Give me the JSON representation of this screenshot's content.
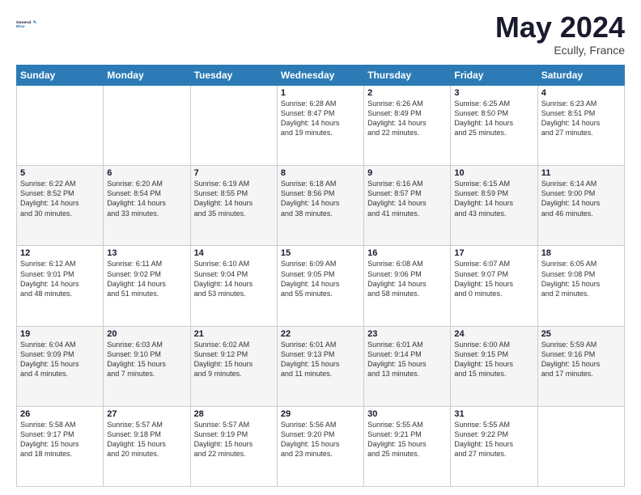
{
  "logo": {
    "line1": "General",
    "line2": "Blue"
  },
  "title": "May 2024",
  "location": "Ecully, France",
  "days_header": [
    "Sunday",
    "Monday",
    "Tuesday",
    "Wednesday",
    "Thursday",
    "Friday",
    "Saturday"
  ],
  "weeks": [
    [
      {
        "num": "",
        "info": ""
      },
      {
        "num": "",
        "info": ""
      },
      {
        "num": "",
        "info": ""
      },
      {
        "num": "1",
        "info": "Sunrise: 6:28 AM\nSunset: 8:47 PM\nDaylight: 14 hours\nand 19 minutes."
      },
      {
        "num": "2",
        "info": "Sunrise: 6:26 AM\nSunset: 8:49 PM\nDaylight: 14 hours\nand 22 minutes."
      },
      {
        "num": "3",
        "info": "Sunrise: 6:25 AM\nSunset: 8:50 PM\nDaylight: 14 hours\nand 25 minutes."
      },
      {
        "num": "4",
        "info": "Sunrise: 6:23 AM\nSunset: 8:51 PM\nDaylight: 14 hours\nand 27 minutes."
      }
    ],
    [
      {
        "num": "5",
        "info": "Sunrise: 6:22 AM\nSunset: 8:52 PM\nDaylight: 14 hours\nand 30 minutes."
      },
      {
        "num": "6",
        "info": "Sunrise: 6:20 AM\nSunset: 8:54 PM\nDaylight: 14 hours\nand 33 minutes."
      },
      {
        "num": "7",
        "info": "Sunrise: 6:19 AM\nSunset: 8:55 PM\nDaylight: 14 hours\nand 35 minutes."
      },
      {
        "num": "8",
        "info": "Sunrise: 6:18 AM\nSunset: 8:56 PM\nDaylight: 14 hours\nand 38 minutes."
      },
      {
        "num": "9",
        "info": "Sunrise: 6:16 AM\nSunset: 8:57 PM\nDaylight: 14 hours\nand 41 minutes."
      },
      {
        "num": "10",
        "info": "Sunrise: 6:15 AM\nSunset: 8:59 PM\nDaylight: 14 hours\nand 43 minutes."
      },
      {
        "num": "11",
        "info": "Sunrise: 6:14 AM\nSunset: 9:00 PM\nDaylight: 14 hours\nand 46 minutes."
      }
    ],
    [
      {
        "num": "12",
        "info": "Sunrise: 6:12 AM\nSunset: 9:01 PM\nDaylight: 14 hours\nand 48 minutes."
      },
      {
        "num": "13",
        "info": "Sunrise: 6:11 AM\nSunset: 9:02 PM\nDaylight: 14 hours\nand 51 minutes."
      },
      {
        "num": "14",
        "info": "Sunrise: 6:10 AM\nSunset: 9:04 PM\nDaylight: 14 hours\nand 53 minutes."
      },
      {
        "num": "15",
        "info": "Sunrise: 6:09 AM\nSunset: 9:05 PM\nDaylight: 14 hours\nand 55 minutes."
      },
      {
        "num": "16",
        "info": "Sunrise: 6:08 AM\nSunset: 9:06 PM\nDaylight: 14 hours\nand 58 minutes."
      },
      {
        "num": "17",
        "info": "Sunrise: 6:07 AM\nSunset: 9:07 PM\nDaylight: 15 hours\nand 0 minutes."
      },
      {
        "num": "18",
        "info": "Sunrise: 6:05 AM\nSunset: 9:08 PM\nDaylight: 15 hours\nand 2 minutes."
      }
    ],
    [
      {
        "num": "19",
        "info": "Sunrise: 6:04 AM\nSunset: 9:09 PM\nDaylight: 15 hours\nand 4 minutes."
      },
      {
        "num": "20",
        "info": "Sunrise: 6:03 AM\nSunset: 9:10 PM\nDaylight: 15 hours\nand 7 minutes."
      },
      {
        "num": "21",
        "info": "Sunrise: 6:02 AM\nSunset: 9:12 PM\nDaylight: 15 hours\nand 9 minutes."
      },
      {
        "num": "22",
        "info": "Sunrise: 6:01 AM\nSunset: 9:13 PM\nDaylight: 15 hours\nand 11 minutes."
      },
      {
        "num": "23",
        "info": "Sunrise: 6:01 AM\nSunset: 9:14 PM\nDaylight: 15 hours\nand 13 minutes."
      },
      {
        "num": "24",
        "info": "Sunrise: 6:00 AM\nSunset: 9:15 PM\nDaylight: 15 hours\nand 15 minutes."
      },
      {
        "num": "25",
        "info": "Sunrise: 5:59 AM\nSunset: 9:16 PM\nDaylight: 15 hours\nand 17 minutes."
      }
    ],
    [
      {
        "num": "26",
        "info": "Sunrise: 5:58 AM\nSunset: 9:17 PM\nDaylight: 15 hours\nand 18 minutes."
      },
      {
        "num": "27",
        "info": "Sunrise: 5:57 AM\nSunset: 9:18 PM\nDaylight: 15 hours\nand 20 minutes."
      },
      {
        "num": "28",
        "info": "Sunrise: 5:57 AM\nSunset: 9:19 PM\nDaylight: 15 hours\nand 22 minutes."
      },
      {
        "num": "29",
        "info": "Sunrise: 5:56 AM\nSunset: 9:20 PM\nDaylight: 15 hours\nand 23 minutes."
      },
      {
        "num": "30",
        "info": "Sunrise: 5:55 AM\nSunset: 9:21 PM\nDaylight: 15 hours\nand 25 minutes."
      },
      {
        "num": "31",
        "info": "Sunrise: 5:55 AM\nSunset: 9:22 PM\nDaylight: 15 hours\nand 27 minutes."
      },
      {
        "num": "",
        "info": ""
      }
    ]
  ]
}
